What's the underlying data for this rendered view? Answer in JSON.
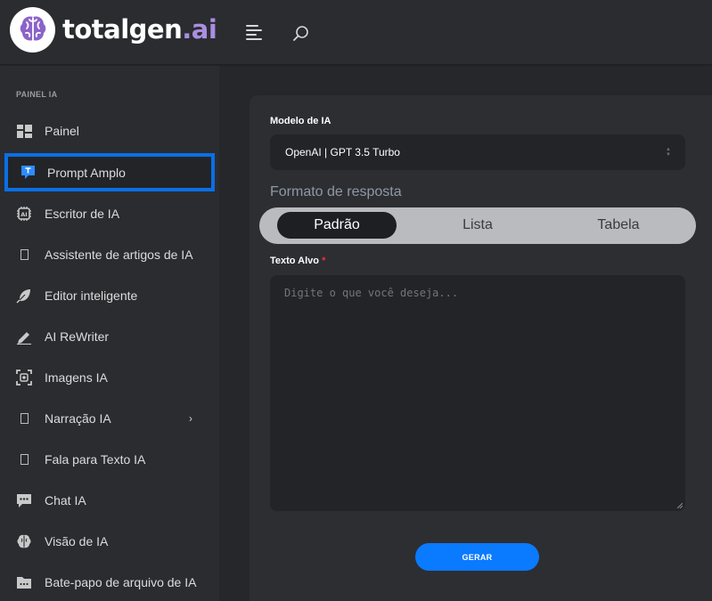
{
  "brand": {
    "name_main": "totalgen",
    "name_accent": ".ai",
    "accent_color": "#a98ee0"
  },
  "sidebar": {
    "section_label": "PAINEL IA",
    "items": [
      {
        "label": "Painel",
        "icon": "dashboard-icon"
      },
      {
        "label": "Prompt Amplo",
        "icon": "text-prompt-icon",
        "active": true
      },
      {
        "label": "Escritor de IA",
        "icon": "ai-chip-icon"
      },
      {
        "label": "Assistente de artigos de IA",
        "icon": "article-icon"
      },
      {
        "label": "Editor inteligente",
        "icon": "feather-icon"
      },
      {
        "label": "AI ReWriter",
        "icon": "pen-icon"
      },
      {
        "label": "Imagens IA",
        "icon": "image-scan-icon"
      },
      {
        "label": "Narração IA",
        "icon": "voice-icon",
        "has_submenu": true
      },
      {
        "label": "Fala para Texto IA",
        "icon": "speech-icon"
      },
      {
        "label": "Chat IA",
        "icon": "chat-icon"
      },
      {
        "label": "Visão de IA",
        "icon": "brain-icon"
      },
      {
        "label": "Bate-papo de arquivo de IA",
        "icon": "folder-chat-icon"
      }
    ]
  },
  "form": {
    "model_label": "Modelo de IA",
    "model_value": "OpenAI | GPT 3.5 Turbo",
    "format_title": "Formato de resposta",
    "formats": [
      "Padrão",
      "Lista",
      "Tabela"
    ],
    "selected_format": "Padrão",
    "target_label": "Texto Alvo",
    "required_mark": "*",
    "target_placeholder": "Digite o que você deseja...",
    "generate_label": "GERAR"
  },
  "colors": {
    "active_border": "#0a6fe6",
    "primary_button": "#0a7aff",
    "required": "#e8333a"
  }
}
